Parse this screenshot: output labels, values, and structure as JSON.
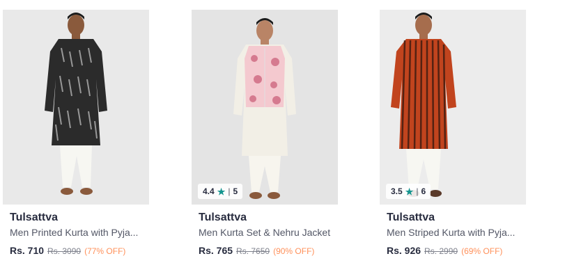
{
  "products": [
    {
      "brand": "Tulsattva",
      "name": "Men Printed Kurta with Pyja...",
      "price": "Rs. 710",
      "mrp": "Rs. 3090",
      "discount": "(77% OFF)",
      "kurta_color": "#2b2b2b",
      "image_icon": "model-kurta-black-ikat-icon"
    },
    {
      "brand": "Tulsattva",
      "name": "Men Kurta Set & Nehru Jacket",
      "price": "Rs. 765",
      "mrp": "Rs. 7650",
      "discount": "(90% OFF)",
      "rating": "4.4",
      "rating_count": "5",
      "kurta_color": "#f2efe6",
      "jacket_color": "#f4c9cf",
      "image_icon": "model-kurta-nehru-jacket-icon"
    },
    {
      "brand": "Tulsattva",
      "name": "Men Striped Kurta with Pyja...",
      "price": "Rs. 926",
      "mrp": "Rs. 2990",
      "discount": "(69% OFF)",
      "rating": "3.5",
      "rating_count": "6",
      "kurta_color": "#c1441e",
      "image_icon": "model-kurta-orange-striped-icon"
    }
  ],
  "colors": {
    "rating_star": "#14958f",
    "discount": "#ff905a",
    "brand_text": "#282c3f",
    "muted_text": "#535766"
  },
  "separator": "|"
}
